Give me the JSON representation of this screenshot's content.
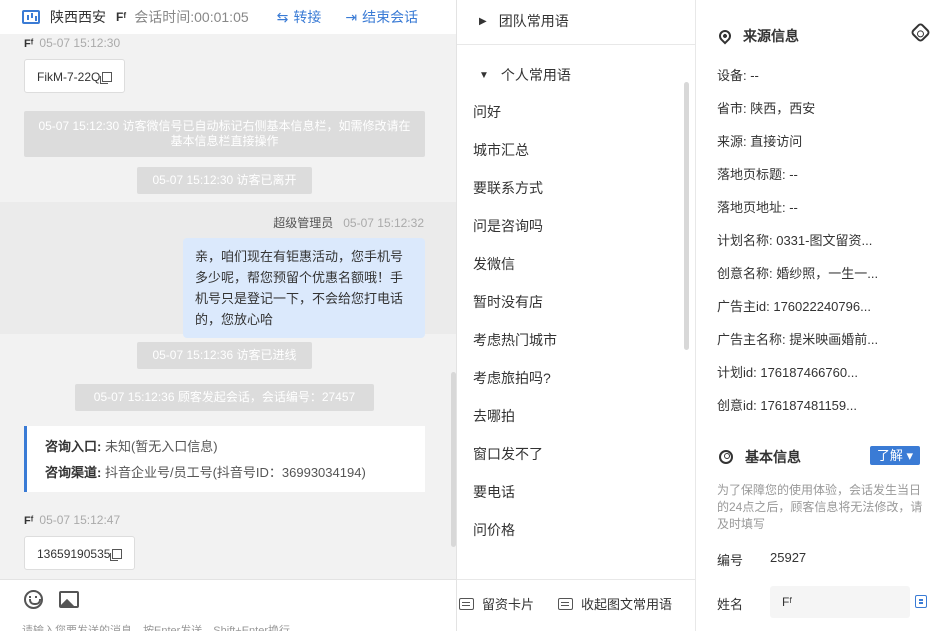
{
  "header": {
    "visitor": "陕西西安",
    "ff": "Fᶠ",
    "time_label": "会话时间:",
    "time_value": "00:01:05",
    "transfer_label": "转接",
    "end_label": "结束会话",
    "transfer_icon": "transfer-icon",
    "end_icon": "exit-icon"
  },
  "chat": {
    "msg1_ff": "Fᶠ",
    "msg1_time": "05-07 15:12:30",
    "msg1_text": "FikM-7-22Q",
    "sys1": "05-07 15:12:30 访客微信号已自动标记右侧基本信息栏，如需修改请在基本信息栏直接操作",
    "sys2": "05-07 15:12:30 访客已离开",
    "agent_name": "超级管理员",
    "agent_time": "05-07 15:12:32",
    "agent_text": "亲，咱们现在有钜惠活动，您手机号多少呢，帮您预留个优惠名额哦！手机号只是登记一下，不会给您打电话的，您放心哈",
    "sys3": "05-07 15:12:36 访客已进线",
    "sys4": "05-07 15:12:36 顾客发起会话，会话编号：27457",
    "entry_label": "咨询入口:",
    "entry_value": "未知(暂无入口信息)",
    "channel_label": "咨询渠道:",
    "channel_value": "抖音企业号/员工号(抖音号ID：36993034194)",
    "msg2_ff": "Fᶠ",
    "msg2_time": "05-07 15:12:47",
    "msg2_text": "13659190535"
  },
  "footer": {
    "hint": "请输入您要发送的消息，按Enter发送，Shift+Enter换行"
  },
  "phrases": {
    "team_label": "团队常用语",
    "personal_label": "个人常用语",
    "items": [
      "问好",
      "城市汇总",
      "要联系方式",
      "问是咨询吗",
      "发微信",
      "暂时没有店",
      "考虑热门城市",
      "考虑旅拍吗?",
      "去哪拍",
      "窗口发不了",
      "要电话",
      "问价格"
    ],
    "card_label": "留资卡片",
    "collapse_label": "收起图文常用语"
  },
  "source": {
    "title": "来源信息",
    "rows": [
      "设备: --",
      "省市: 陕西，西安",
      "来源: 直接访问",
      "落地页标题: --",
      "落地页地址: --",
      "计划名称: 0331-图文留资...",
      "创意名称: 婚纱照，一生一...",
      "广告主id: 176022240796...",
      "广告主名称: 提米映画婚前...",
      "计划id: 176187466760...",
      "创意id: 176187481159..."
    ]
  },
  "basic": {
    "title": "基本信息",
    "learn_label": "了解 ▾",
    "notice": "为了保障您的使用体验，会话发生当日的24点之后，顾客信息将无法修改，请及时填写",
    "id_label": "编号",
    "id_value": "25927",
    "name_label": "姓名",
    "name_value": "Fᶠ"
  }
}
